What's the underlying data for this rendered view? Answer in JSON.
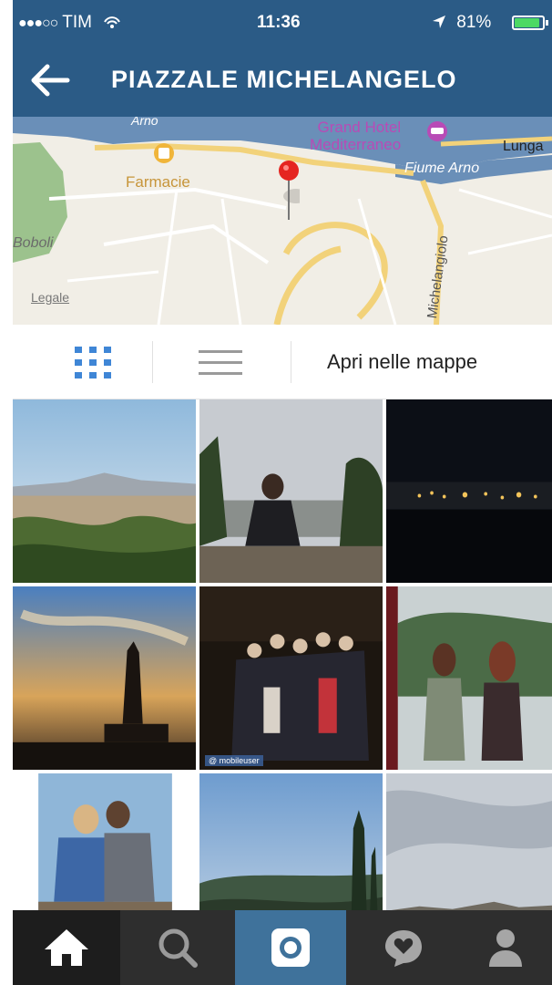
{
  "status_bar": {
    "carrier_signal": "●●●○○",
    "carrier": "TIM",
    "time": "11:36",
    "battery_percent": "81%"
  },
  "nav": {
    "title": "PIAZZALE MICHELANGELO"
  },
  "map": {
    "labels": {
      "farmacie": "Farmacie",
      "hotel_line1": "Grand Hotel",
      "hotel_line2": "Mediterraneo",
      "lunga": "Lunga",
      "river": "Fiume Arno",
      "arno_top": "Arno",
      "boboli": "Boboli",
      "street": "Michelangiolo"
    },
    "legal_link": "Legale"
  },
  "toolbar": {
    "open_in_maps": "Apri nelle mappe"
  },
  "photos": [
    {
      "subject": "florence panorama"
    },
    {
      "subject": "person sitting on wall"
    },
    {
      "subject": "city at night"
    },
    {
      "subject": "statue at sunset"
    },
    {
      "subject": "group of friends",
      "watermark": "@ mobileuser"
    },
    {
      "subject": "two women"
    },
    {
      "subject": "couple on bench"
    },
    {
      "subject": "cypress trees"
    },
    {
      "subject": "cloudy skyline"
    }
  ],
  "tabs": [
    {
      "name": "home",
      "icon": "home-icon"
    },
    {
      "name": "search",
      "icon": "search-icon"
    },
    {
      "name": "camera",
      "icon": "camera-icon"
    },
    {
      "name": "activity",
      "icon": "heart-bubble-icon"
    },
    {
      "name": "profile",
      "icon": "profile-icon"
    }
  ],
  "colors": {
    "header_bg": "#2b5b86",
    "tab_bar_bg": "#2e2e2e",
    "active_tab_bg": "#3f729b",
    "grid_icon_active": "#3f86d6",
    "battery_green": "#4cd964"
  }
}
